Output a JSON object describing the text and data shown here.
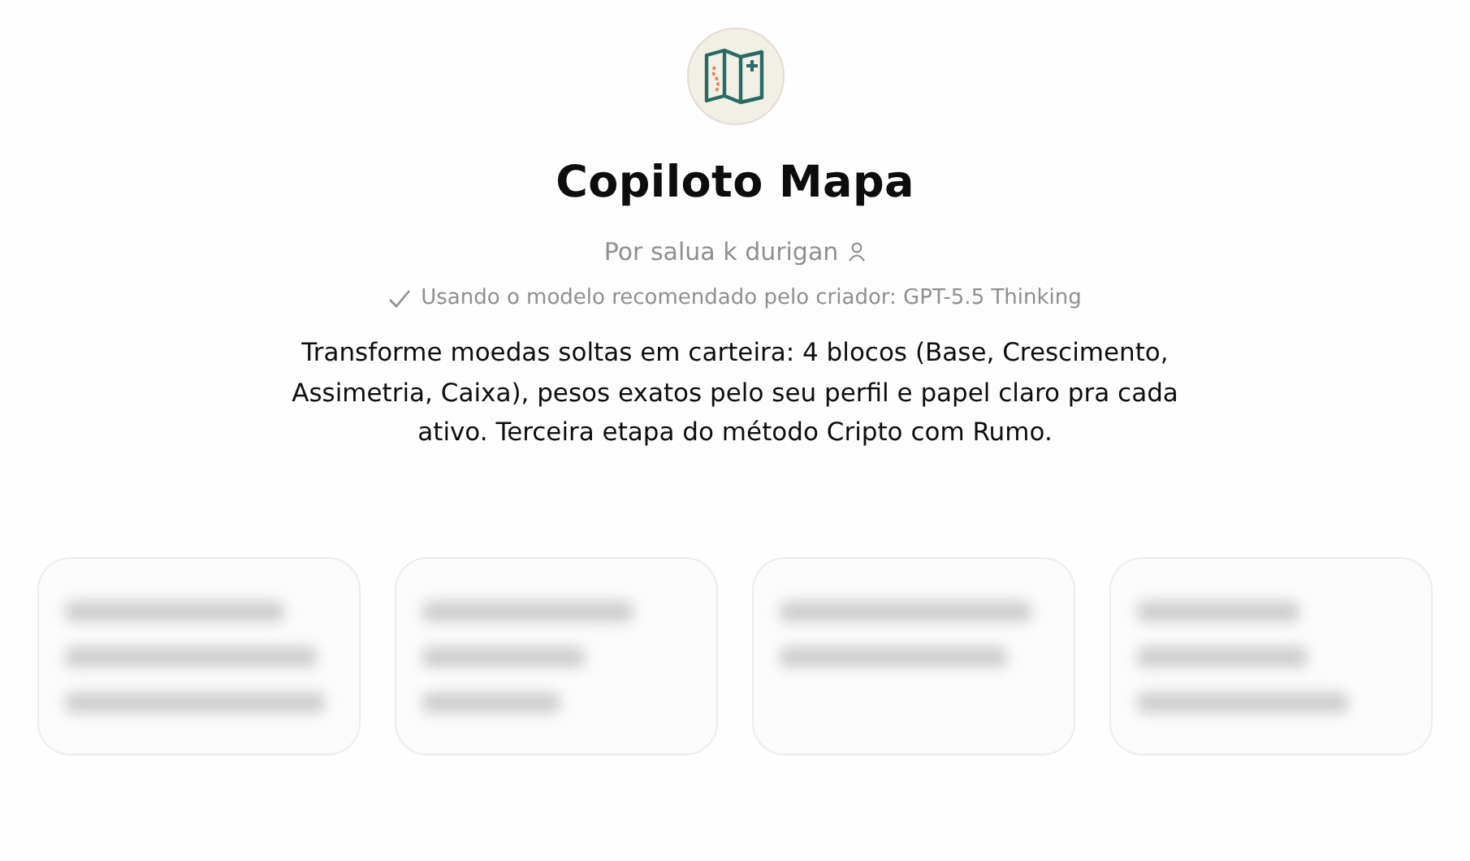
{
  "title": "Copiloto Mapa",
  "byline": "Por salua k durigan",
  "model_note": "Usando o modelo recomendado pelo criador: GPT-5.5 Thinking",
  "description": "Transforme moedas soltas em carteira: 4 blocos (Base, Crescimento, Assimetria, Caixa), pesos exatos pelo seu perfil e papel claro pra cada ativo. Terceira etapa do método Cripto com Rumo.",
  "starter_cards": [
    {
      "kind": "blurred"
    },
    {
      "kind": "blurred"
    },
    {
      "kind": "blurred"
    },
    {
      "kind": "blurred"
    }
  ]
}
